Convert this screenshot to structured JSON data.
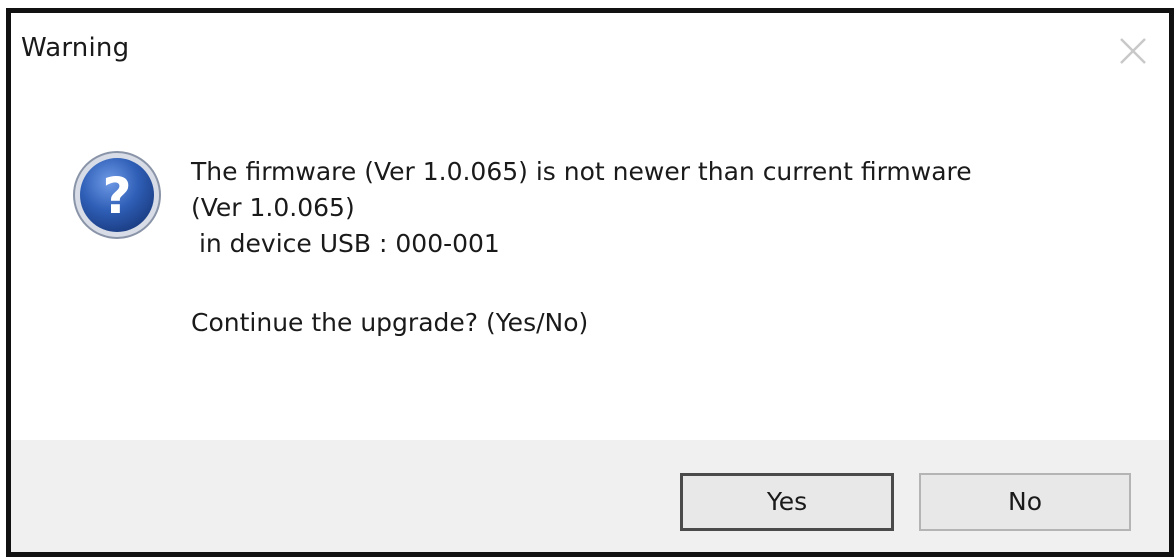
{
  "dialog": {
    "title": "Warning",
    "icon": "question-icon",
    "message": {
      "line1": "The firmware (Ver 1.0.065) is not newer than current firmware",
      "line2": "(Ver 1.0.065)",
      "line3": " in device USB : 000-001",
      "line4": "Continue the upgrade? (Yes/No)"
    },
    "buttons": {
      "yes": "Yes",
      "no": "No"
    }
  },
  "colors": {
    "icon_blue": "#2f5fb7",
    "footer_bg": "#f0f0f0",
    "border": "#111111"
  }
}
